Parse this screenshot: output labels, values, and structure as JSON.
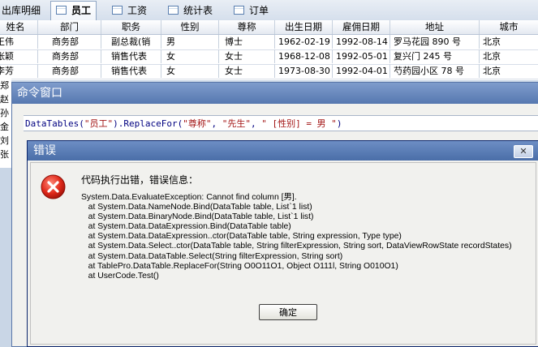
{
  "tabs": [
    {
      "label": "出库明细",
      "active": false
    },
    {
      "label": "员工",
      "active": true
    },
    {
      "label": "工资",
      "active": false
    },
    {
      "label": "统计表",
      "active": false
    },
    {
      "label": "订单",
      "active": false
    }
  ],
  "grid": {
    "columns": [
      "姓名",
      "部门",
      "职务",
      "性别",
      "尊称",
      "出生日期",
      "雇佣日期",
      "地址",
      "城市"
    ],
    "rows": [
      [
        "王伟",
        "商务部",
        "副总裁(销",
        "男",
        "博士",
        "1962-02-19",
        "1992-08-14",
        "罗马花园 890 号",
        "北京"
      ],
      [
        "张颖",
        "商务部",
        "销售代表",
        "女",
        "女士",
        "1968-12-08",
        "1992-05-01",
        "复兴门 245 号",
        "北京"
      ],
      [
        "李芳",
        "商务部",
        "销售代表",
        "女",
        "女士",
        "1973-08-30",
        "1992-04-01",
        "芍药园小区 78 号",
        "北京"
      ]
    ]
  },
  "left_stub_text": [
    "郑",
    "赵",
    "孙",
    "金",
    "刘",
    "张"
  ],
  "command_window": {
    "title": "命令窗口",
    "command_parts": [
      {
        "t": "DataTables(",
        "c": "k"
      },
      {
        "t": "\"员工\"",
        "c": "s"
      },
      {
        "t": ").ReplaceFor(",
        "c": "k"
      },
      {
        "t": "\"尊称\"",
        "c": "s"
      },
      {
        "t": ", ",
        "c": "k"
      },
      {
        "t": "\"先生\"",
        "c": "s"
      },
      {
        "t": ", ",
        "c": "k"
      },
      {
        "t": "\" [性别] = 男 \"",
        "c": "s"
      },
      {
        "t": ")",
        "c": "k"
      }
    ]
  },
  "error_dialog": {
    "title": "错误",
    "close_label": "✕",
    "heading": "代码执行出错，错误信息：",
    "message": "System.Data.EvaluateException: Cannot find column [男].\n   at System.Data.NameNode.Bind(DataTable table, List`1 list)\n   at System.Data.BinaryNode.Bind(DataTable table, List`1 list)\n   at System.Data.DataExpression.Bind(DataTable table)\n   at System.Data.DataExpression..ctor(DataTable table, String expression, Type type)\n   at System.Data.Select..ctor(DataTable table, String filterExpression, String sort, DataViewRowState recordStates)\n   at System.Data.DataTable.Select(String filterExpression, String sort)\n   at TablePro.DataTable.ReplaceFor(String O0O11O1, Object O111l, String O010O1)\n   at UserCode.Test()",
    "ok_label": "确定",
    "icon": "error-icon"
  }
}
